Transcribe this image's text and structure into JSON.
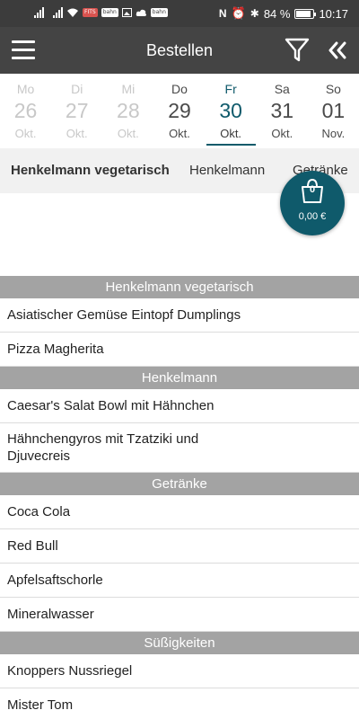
{
  "status_bar": {
    "mini_icon_1": "FITS",
    "mini_icon_2": "bahn",
    "mini_icon_3": "bahn",
    "battery": "84 %",
    "time": "10:17"
  },
  "app_bar": {
    "title": "Bestellen",
    "menu_icon": "hamburger-icon",
    "filter_icon": "filter-icon",
    "collapse_icon": "double-chevron-left-icon"
  },
  "days": [
    {
      "dow": "Mo",
      "num": "26",
      "mon": "Okt."
    },
    {
      "dow": "Di",
      "num": "27",
      "mon": "Okt."
    },
    {
      "dow": "Mi",
      "num": "28",
      "mon": "Okt."
    },
    {
      "dow": "Do",
      "num": "29",
      "mon": "Okt."
    },
    {
      "dow": "Fr",
      "num": "30",
      "mon": "Okt."
    },
    {
      "dow": "Sa",
      "num": "31",
      "mon": "Okt."
    },
    {
      "dow": "So",
      "num": "01",
      "mon": "Nov."
    }
  ],
  "selected_day": "Fr",
  "category_tabs": [
    "Henkelmann vegetarisch",
    "Henkelmann",
    "Getränke"
  ],
  "cart": {
    "count": "0",
    "total": "0,00 €",
    "icon": "basket-icon"
  },
  "sections": [
    {
      "title": "Henkelmann vegetarisch",
      "items": [
        "Asiatischer Gemüse Eintopf Dumplings",
        "Pizza Magherita"
      ]
    },
    {
      "title": "Henkelmann",
      "items": [
        "Caesar's Salat Bowl mit Hähnchen",
        "Hähnchengyros mit Tzatziki und Djuvecreis"
      ]
    },
    {
      "title": "Getränke",
      "items": [
        "Coca Cola",
        "Red Bull",
        "Apfelsaftschorle",
        "Mineralwasser"
      ]
    },
    {
      "title": "Süßigkeiten",
      "items": [
        "Knoppers Nussriegel",
        "Mister Tom"
      ]
    }
  ],
  "colors": {
    "primary": "#0f5a6b",
    "appbar": "#444444",
    "section_header": "#a3a3a3",
    "tab_bar": "#f1f1f1"
  }
}
